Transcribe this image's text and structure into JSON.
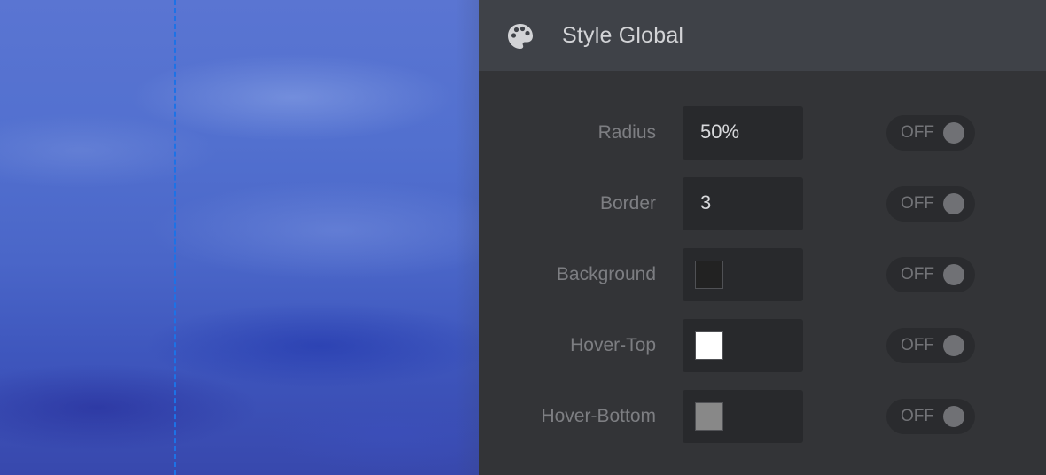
{
  "panel": {
    "title": "Style Global",
    "icon": "palette-icon"
  },
  "rows": [
    {
      "label": "Radius",
      "value": "50%",
      "toggle": "OFF"
    },
    {
      "label": "Border",
      "value": "3",
      "toggle": "OFF"
    },
    {
      "label": "Background",
      "swatch_color": "#222222",
      "toggle": "OFF"
    },
    {
      "label": "Hover-Top",
      "swatch_color": "#ffffff",
      "toggle": "OFF"
    },
    {
      "label": "Hover-Bottom",
      "swatch_color": "#888888",
      "toggle": "OFF"
    }
  ],
  "colors": {
    "guide_line": "#1d72e6",
    "panel_bg": "#333437",
    "header_bg": "#3f4248"
  }
}
